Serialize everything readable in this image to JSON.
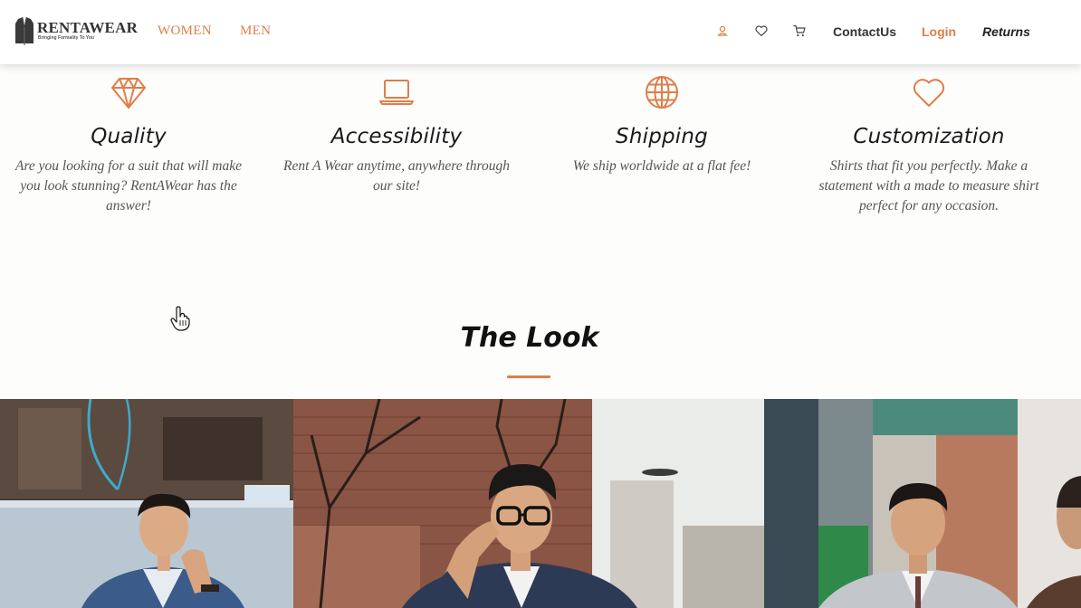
{
  "header": {
    "logo_text": "RENTAWEAR",
    "logo_tagline": "Bringing Formality To You",
    "nav": {
      "women": "WOMEN",
      "men": "MEN"
    },
    "icons": [
      "user-icon",
      "heart-icon",
      "cart-icon"
    ],
    "contact_label": "ContactUs",
    "login_label": "Login",
    "returns_label": "Returns"
  },
  "features": [
    {
      "icon": "diamond-icon",
      "title": "Quality",
      "text": "Are you looking for a suit that will make you look stunning? RentAWear has the answer!"
    },
    {
      "icon": "laptop-icon",
      "title": "Accessibility",
      "text": "Rent A Wear anytime, anywhere through our site!"
    },
    {
      "icon": "globe-icon",
      "title": "Shipping",
      "text": "We ship worldwide at a flat fee!"
    },
    {
      "icon": "heart-outline-icon",
      "title": "Customization",
      "text": "Shirts that fit you perfectly. Make a statement with a made to measure shirt perfect for any occasion."
    }
  ],
  "look": {
    "title": "The Look"
  },
  "colors": {
    "accent": "#e07d48",
    "text_dark": "#1a1a1a",
    "text_muted": "#555555"
  }
}
